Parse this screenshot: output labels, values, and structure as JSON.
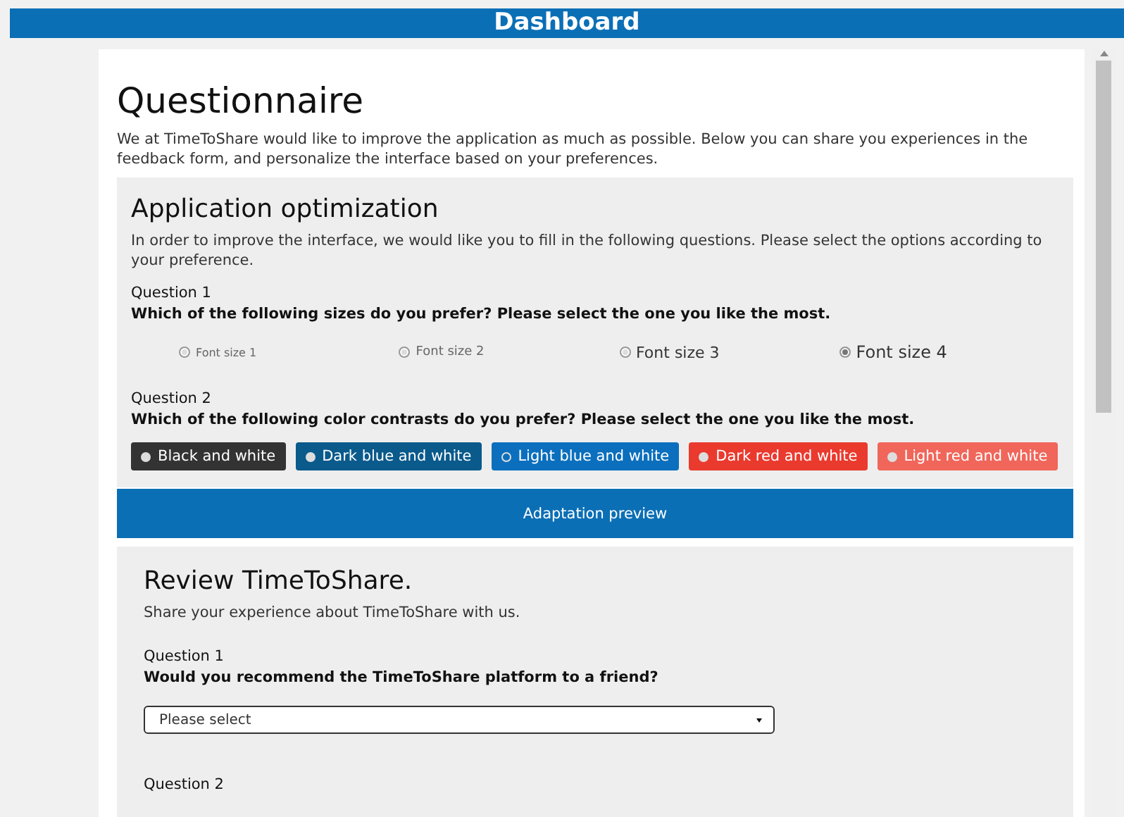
{
  "header": {
    "title": "Dashboard"
  },
  "questionnaire": {
    "title": "Questionnaire",
    "intro": "We at TimeToShare would like to improve the application as much as possible. Below you can share you experiences in the feedback form, and personalize the interface based on your preferences."
  },
  "optimization": {
    "title": "Application optimization",
    "intro": "In order to improve the interface, we would like you to fill in the following questions. Please select the options according to your preference.",
    "question_1": {
      "label": "Question 1",
      "text": "Which of the following sizes do you prefer? Please select the one you like the most.",
      "options": [
        {
          "label": "Font size 1",
          "selected": false
        },
        {
          "label": "Font size 2",
          "selected": false
        },
        {
          "label": "Font size 3",
          "selected": false
        },
        {
          "label": "Font size 4",
          "selected": true
        }
      ]
    },
    "question_2": {
      "label": "Question 2",
      "text": "Which of the following color contrasts do you prefer? Please select the one you like the most.",
      "options": [
        {
          "label": "Black and white",
          "color": "#333333",
          "selected": false
        },
        {
          "label": "Dark blue and white",
          "color": "#0a5a8c",
          "selected": false
        },
        {
          "label": "Light blue and white",
          "color": "#0b6fbd",
          "selected": true
        },
        {
          "label": "Dark red and white",
          "color": "#ea3a2e",
          "selected": false
        },
        {
          "label": "Light red and white",
          "color": "#f0665a",
          "selected": false
        }
      ]
    },
    "preview_button": "Adaptation preview"
  },
  "review": {
    "title": "Review TimeToShare.",
    "intro": "Share your experience about TimeToShare with us.",
    "question_1": {
      "label": "Question 1",
      "text": "Would you recommend the TimeToShare platform to a friend?",
      "select": "Please select"
    },
    "question_2": {
      "label": "Question 2"
    }
  }
}
